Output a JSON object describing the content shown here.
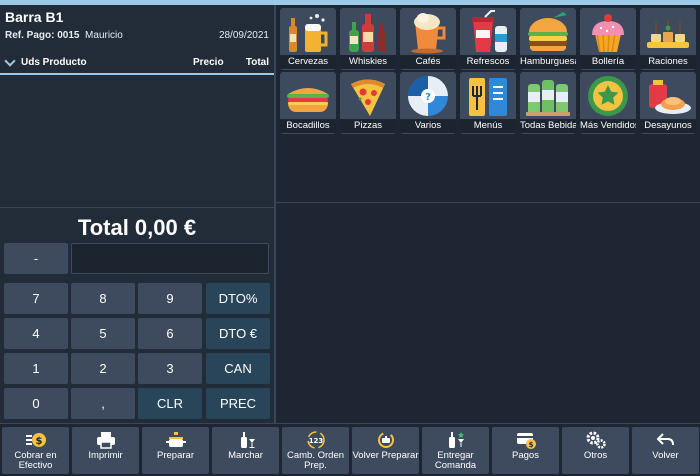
{
  "ticket": {
    "title": "Barra B1",
    "ref_label": "Ref. Pago: 0015",
    "waiter": "Mauricio",
    "date": "28/09/2021",
    "columns": {
      "uds_producto": "Uds Producto",
      "precio": "Precio",
      "total": "Total"
    },
    "total_text": "Total 0,00 €"
  },
  "keypad": {
    "minus": "-",
    "k7": "7",
    "k8": "8",
    "k9": "9",
    "dto_pct": "DTO%",
    "k4": "4",
    "k5": "5",
    "k6": "6",
    "dto_eur": "DTO €",
    "k1": "1",
    "k2": "2",
    "k3": "3",
    "can": "CAN",
    "k0": "0",
    "comma": ",",
    "clr": "CLR",
    "prec": "PREC"
  },
  "categories": [
    {
      "label": "Cervezas",
      "icon": "beer-icon"
    },
    {
      "label": "Whiskies",
      "icon": "whisky-icon"
    },
    {
      "label": "Cafés",
      "icon": "coffee-icon"
    },
    {
      "label": "Refrescos",
      "icon": "soda-icon"
    },
    {
      "label": "Hamburguesas",
      "icon": "burger-icon"
    },
    {
      "label": "Bollería",
      "icon": "cupcake-icon"
    },
    {
      "label": "Raciones",
      "icon": "tapas-icon"
    },
    {
      "label": "Bocadillos",
      "icon": "sandwich-icon"
    },
    {
      "label": "Pizzas",
      "icon": "pizza-icon"
    },
    {
      "label": "Varios",
      "icon": "misc-wheel-icon"
    },
    {
      "label": "Menús",
      "icon": "menu-icon"
    },
    {
      "label": "Todas Bebidas",
      "icon": "drinks-icon"
    },
    {
      "label": "Más Vendidos",
      "icon": "star-badge-icon"
    },
    {
      "label": "Desayunos",
      "icon": "breakfast-icon"
    }
  ],
  "toolbar": {
    "cobrar": "Cobrar en Efectivo",
    "imprimir": "Imprimir",
    "preparar": "Preparar",
    "marchar": "Marchar",
    "camb_orden": "Camb. Orden Prep.",
    "volver_preparar": "Volver Preparar",
    "entregar": "Entregar Comanda",
    "pagos": "Pagos",
    "otros": "Otros",
    "volver": "Volver"
  },
  "colors": {
    "background": "#1e2633",
    "button": "#3e4a5e",
    "function_key": "#284559",
    "accent": "#9cc9e8"
  }
}
